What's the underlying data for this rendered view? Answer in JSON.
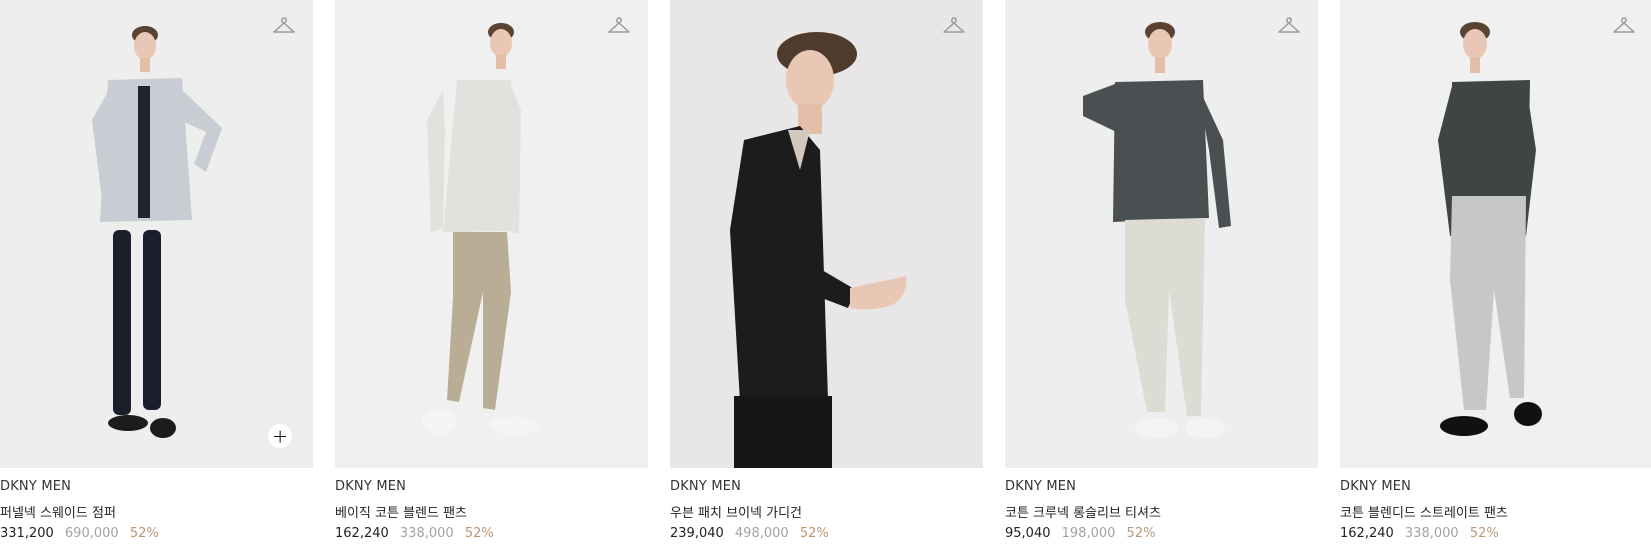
{
  "products": [
    {
      "brand": "DKNY MEN",
      "name": "퍼넬넥 스웨이드 점퍼",
      "price": "331,200",
      "original_price": "690,000",
      "discount": "52%",
      "image_bg": "#eeeeee",
      "top_color": "#c7cdd2",
      "bottom_color": "#1b1f2c",
      "shoe_color": "#1c1c1c"
    },
    {
      "brand": "DKNY MEN",
      "name": "베이직 코튼 블렌드 팬츠",
      "price": "162,240",
      "original_price": "338,000",
      "discount": "52%",
      "image_bg": "#f0f0f0",
      "top_color": "#e3e1de",
      "bottom_color": "#b9ad95",
      "shoe_color": "#f5f5f5"
    },
    {
      "brand": "DKNY MEN",
      "name": "우븐 패치 브이넥 가디건",
      "price": "239,040",
      "original_price": "498,000",
      "discount": "52%",
      "image_bg": "#e8e6e6",
      "top_color": "#1c1c1c",
      "bottom_color": "#161616",
      "shoe_color": "#161616"
    },
    {
      "brand": "DKNY MEN",
      "name": "코튼 크루넥 롱슬리브 티셔츠",
      "price": "95,040",
      "original_price": "198,000",
      "discount": "52%",
      "image_bg": "#eeeeee",
      "top_color": "#4a5052",
      "bottom_color": "#dcdcd4",
      "shoe_color": "#f4f4f4"
    },
    {
      "brand": "DKNY MEN",
      "name": "코튼 블렌디드 스트레이트 팬츠",
      "price": "162,240",
      "original_price": "338,000",
      "discount": "52%",
      "image_bg": "#f0f0f0",
      "top_color": "#3f4544",
      "bottom_color": "#c5c8c4",
      "shoe_color": "#111111"
    }
  ],
  "icons": {
    "wishlist": "hanger-icon",
    "quick_add": "plus-icon"
  }
}
